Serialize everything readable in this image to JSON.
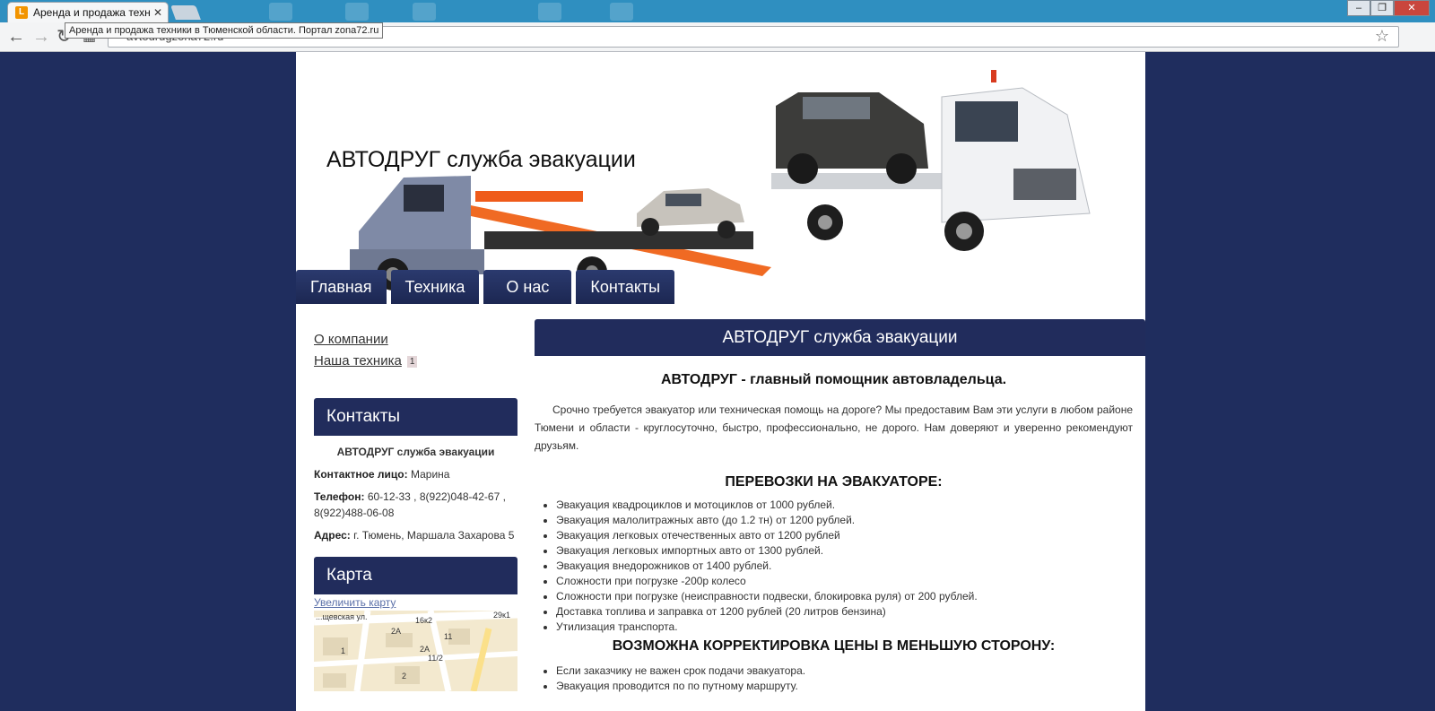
{
  "browser": {
    "tab_title": "Аренда и продажа техни",
    "tab_favicon": "L",
    "tooltip": "Аренда и продажа техники в Тюменской области. Портал zona72.ru",
    "address": "avtodrugzona72.ru",
    "icons": [
      "back-icon",
      "forward-icon",
      "reload-icon",
      "star-icon",
      "close-icon",
      "minimize-icon",
      "maximize-icon"
    ]
  },
  "header": {
    "site_title": "АВТОДРУГ служба эвакуации"
  },
  "topnav": {
    "items": [
      "Главная",
      "Техника",
      "О нас",
      "Контакты"
    ]
  },
  "sidebar": {
    "links": [
      {
        "label": "О компании"
      },
      {
        "label": "Наша техника",
        "badge": "1"
      }
    ],
    "contacts": {
      "title": "Контакты",
      "company": "АВТОДРУГ служба эвакуации",
      "person_label": "Контактное лицо:",
      "person_value": "Марина",
      "phone_label": "Телефон:",
      "phone_value": "60-12-33 , 8(922)048-42-67 , 8(922)488-06-08",
      "address_label": "Адрес:",
      "address_value": "г. Тюмень, Маршала Захарова 5"
    },
    "map": {
      "title": "Карта",
      "link": "Увеличить карту",
      "labels": [
        "...щевская ул.",
        "16к2",
        "29к1",
        "2А",
        "11",
        "2А",
        "11/2",
        "1",
        "2"
      ]
    }
  },
  "main": {
    "header": "АВТОДРУГ служба эвакуации",
    "subtitle": "АВТОДРУГ - главный помощник автовладельца.",
    "intro": "Срочно требуется эвакуатор или техническая помощь на дороге? Мы предоставим Вам эти услуги в любом районе Тюмени и области - круглосуточно, быстро, профессионально, не дорого. Нам доверяют и уверенно рекомендуют друзьям.",
    "services_heading": "ПЕРЕВОЗКИ НА ЭВАКУАТОРЕ:",
    "services": [
      "Эвакуация квадроциклов и мотоциклов от 1000 рублей.",
      "Эвакуация малолитражных авто (до 1.2 тн) от 1200 рублей.",
      "Эвакуация легковых отечественных авто от 1200 рублей",
      "Эвакуация легковых импортных авто от 1300 рублей.",
      "Эвакуация внедорожников от 1400 рублей.",
      "Сложности при погрузке -200р колесо",
      "Сложности при погрузке (неисправности подвески, блокировка руля) от 200 рублей.",
      "Доставка топлива и заправка от 1200 рублей (20 литров бензина)",
      "Утилизация транспорта."
    ],
    "note_heading": "ВОЗМОЖНА КОРРЕКТИРОВКА ЦЕНЫ В МЕНЬШУЮ СТОРОНУ:",
    "notes": [
      "Если заказчику не важен срок подачи эвакуатора.",
      "Эвакуация проводится по по путному маршруту."
    ]
  }
}
